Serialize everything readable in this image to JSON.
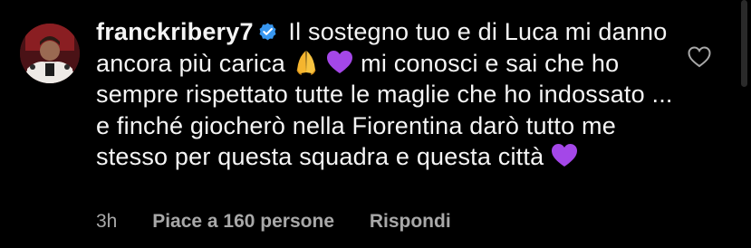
{
  "comment": {
    "username": "franckribery7",
    "verified": true,
    "text_part1": "Il sostegno tuo e di Luca mi danno ancora più carica",
    "emoji_1": "folded-hands",
    "emoji_2": "purple-heart",
    "text_part2": "mi conosci e sai che ho sempre rispettato tutte le maglie che ho indossato ... e finché giocherò nella Fiorentina darò tutto me stesso per questa squadra e questa città",
    "emoji_3": "purple-heart"
  },
  "meta": {
    "time": "3h",
    "likes": "Piace a 160 persone",
    "reply": "Rispondi"
  },
  "colors": {
    "background": "#000000",
    "text": "#f5f5f5",
    "secondary": "#a8a8a8",
    "verified_badge": "#3897f0",
    "purple_heart": "#a447e8"
  },
  "icons": {
    "like": "heart-outline-icon",
    "verified": "verified-badge-icon"
  }
}
